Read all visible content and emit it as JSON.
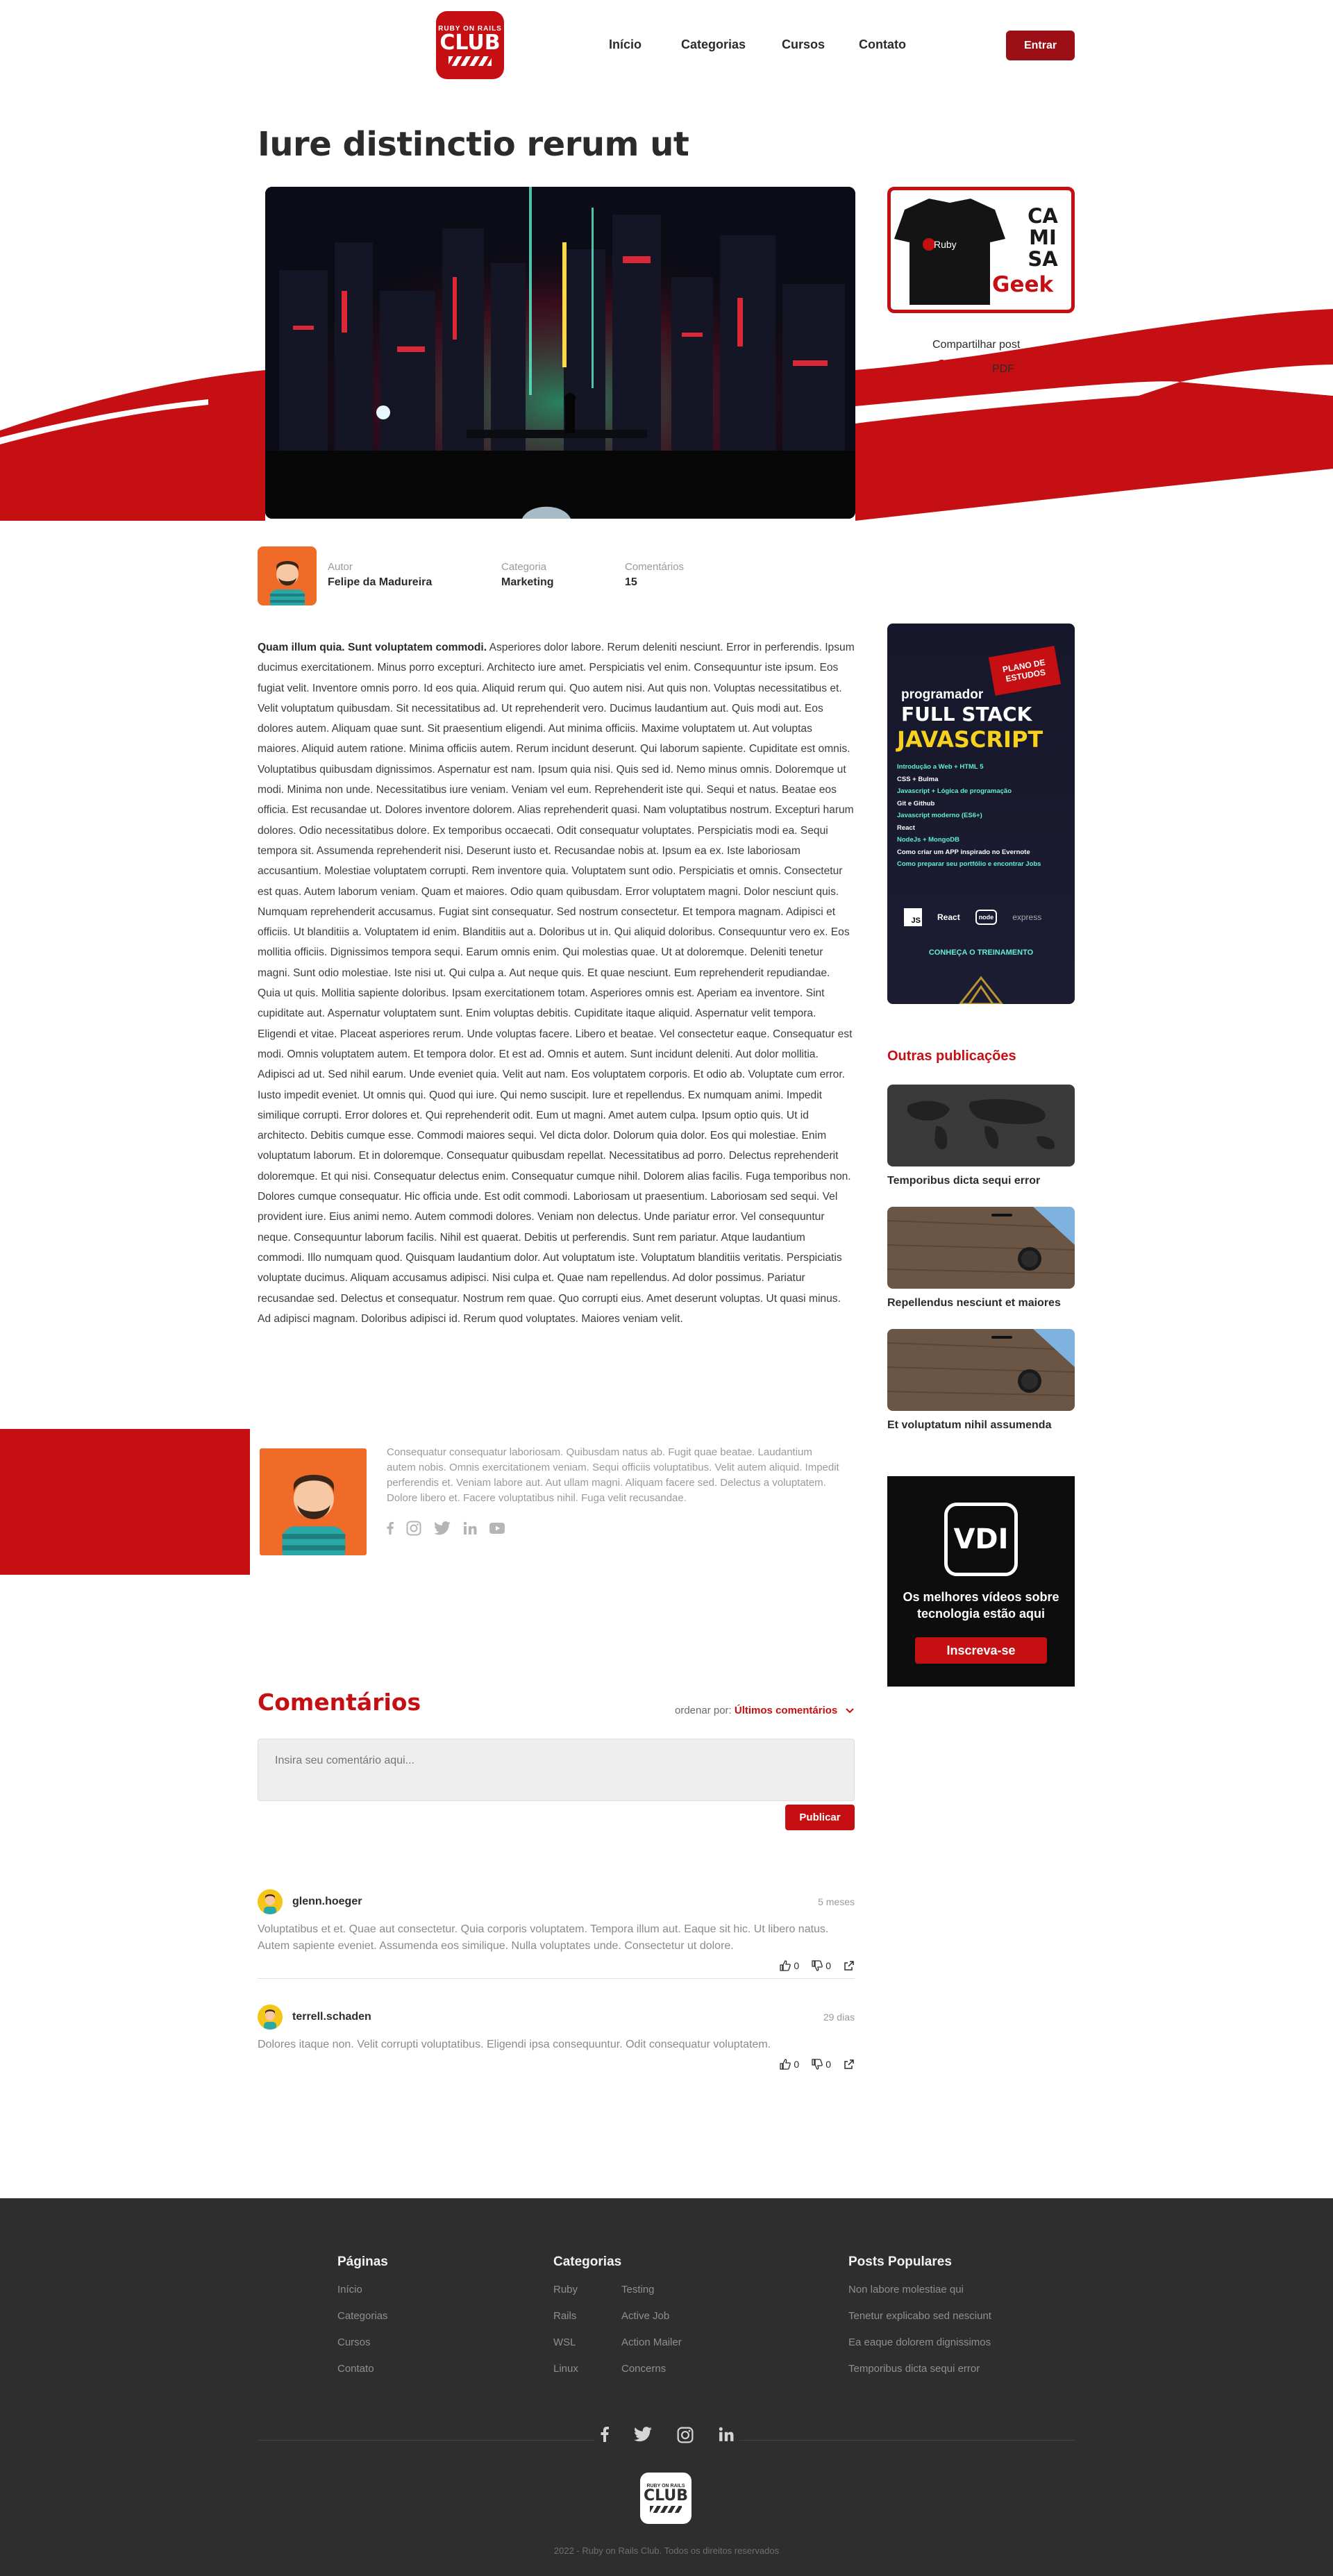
{
  "header": {
    "logo_top": "RUBY ON RAILS",
    "logo_main": "CLUB",
    "nav": [
      "Início",
      "Categorias",
      "Cursos",
      "Contato"
    ],
    "login_label": "Entrar"
  },
  "post": {
    "title": "Iure distinctio rerum ut",
    "share_label": "Compartilhar post",
    "share_pdf": "PDF",
    "author_label": "Autor",
    "author": "Felipe da Madureira",
    "category_label": "Categoria",
    "category": "Marketing",
    "comments_label": "Comentários",
    "comments_count": "15",
    "lead": "Quam illum quia. Sunt voluptatem commodi.",
    "body": "Asperiores dolor labore. Rerum deleniti nesciunt. Error in perferendis. Ipsum ducimus exercitationem. Minus porro excepturi. Architecto iure amet. Perspiciatis vel enim. Consequuntur iste ipsum. Eos fugiat velit. Inventore omnis porro. Id eos quia. Aliquid rerum qui. Quo autem nisi. Aut quis non. Voluptas necessitatibus et. Velit voluptatum quibusdam. Sit necessitatibus ad. Ut reprehenderit vero. Ducimus laudantium aut. Quis modi aut. Eos dolores autem. Aliquam quae sunt. Sit praesentium eligendi. Aut minima officiis. Maxime voluptatem ut. Aut voluptas maiores. Aliquid autem ratione. Minima officiis autem. Rerum incidunt deserunt. Qui laborum sapiente. Cupiditate est omnis. Voluptatibus quibusdam dignissimos. Aspernatur est nam. Ipsum quia nisi. Quis sed id. Nemo minus omnis. Doloremque ut modi. Minima non unde. Necessitatibus iure veniam. Veniam vel eum. Reprehenderit iste qui. Sequi et natus. Beatae eos officia. Est recusandae ut. Dolores inventore dolorem. Alias reprehenderit quasi. Nam voluptatibus nostrum. Excepturi harum dolores. Odio necessitatibus dolore. Ex temporibus occaecati. Odit consequatur voluptates. Perspiciatis modi ea. Sequi tempora sit. Assumenda reprehenderit nisi. Deserunt iusto et. Recusandae nobis at. Ipsum ea ex. Iste laboriosam accusantium. Molestiae voluptatem corrupti. Rem inventore quia. Voluptatem sunt odio. Perspiciatis et omnis. Consectetur est quas. Autem laborum veniam. Quam et maiores. Odio quam quibusdam. Error voluptatem magni. Dolor nesciunt quis. Numquam reprehenderit accusamus. Fugiat sint consequatur. Sed nostrum consectetur. Et tempora magnam. Adipisci et officiis. Ut blanditiis a. Voluptatem id enim. Blanditiis aut a. Doloribus ut in. Qui aliquid doloribus. Consequuntur vero ex. Eos mollitia officiis. Dignissimos tempora sequi. Earum omnis enim. Qui molestias quae. Ut at doloremque. Deleniti tenetur magni. Sunt odio molestiae. Iste nisi ut. Qui culpa a. Aut neque quis. Et quae nesciunt. Eum reprehenderit repudiandae. Quia ut quis. Mollitia sapiente doloribus. Ipsam exercitationem totam. Asperiores omnis est. Aperiam ea inventore. Sint cupiditate aut. Aspernatur voluptatem sunt. Enim voluptas debitis. Cupiditate itaque aliquid. Aspernatur velit tempora. Eligendi et vitae. Placeat asperiores rerum. Unde voluptas facere. Libero et beatae. Vel consectetur eaque. Consequatur est modi. Omnis voluptatem autem. Et tempora dolor. Et est ad. Omnis et autem. Sunt incidunt deleniti. Aut dolor mollitia. Adipisci ad ut. Sed nihil earum. Unde eveniet quia. Velit aut nam. Eos voluptatem corporis. Et odio ab. Voluptate cum error. Iusto impedit eveniet. Ut omnis qui. Quod qui iure. Qui nemo suscipit. Iure et repellendus. Ex numquam animi. Impedit similique corrupti. Error dolores et. Qui reprehenderit odit. Eum ut magni. Amet autem culpa. Ipsum optio quis. Ut id architecto. Debitis cumque esse. Commodi maiores sequi. Vel dicta dolor. Dolorum quia dolor. Eos qui molestiae. Enim voluptatum laborum. Et in doloremque. Consequatur quibusdam repellat. Necessitatibus ad porro. Delectus reprehenderit doloremque. Et qui nisi. Consequatur delectus enim. Consequatur cumque nihil. Dolorem alias facilis. Fuga temporibus non. Dolores cumque consequatur. Hic officia unde. Est odit commodi. Laboriosam ut praesentium. Laboriosam sed sequi. Vel provident iure. Eius animi nemo. Autem commodi dolores. Veniam non delectus. Unde pariatur error. Vel consequuntur neque. Consequuntur laborum facilis. Nihil est quaerat. Debitis ut perferendis. Sunt rem pariatur. Atque laudantium commodi. Illo numquam quod. Quisquam laudantium dolor. Aut voluptatum iste. Voluptatum blanditiis veritatis. Perspiciatis voluptate ducimus. Aliquam accusamus adipisci. Nisi culpa et. Quae nam repellendus. Ad dolor possimus. Pariatur recusandae sed. Delectus et consequatur. Nostrum rem quae. Quo corrupti eius. Amet deserunt voluptas. Ut quasi minus. Ad adipisci magnam. Doloribus adipisci id. Rerum quod voluptates. Maiores veniam velit."
  },
  "shirt_ad": {
    "brand": "Ruby",
    "line1": "CA",
    "line2": "MI",
    "line3": "SA",
    "line4": "Geek"
  },
  "course_ad": {
    "badge": "PLANO DE ESTUDOS",
    "kicker": "programador",
    "title1": "FULL STACK",
    "title2": "JAVASCRIPT",
    "items": [
      "Introdução a Web + HTML 5",
      "CSS + Bulma",
      "Javascript + Lógica de programação",
      "Git e Github",
      "Javascript moderno (ES6+)",
      "React",
      "NodeJs + MongoDB",
      "Como criar um APP inspirado no Evernote",
      "Como preparar seu portfólio e encontrar Jobs"
    ],
    "logos": [
      "JS",
      "React",
      "node",
      "express"
    ],
    "cta": "CONHEÇA O TREINAMENTO"
  },
  "sidebar": {
    "others_title": "Outras publicações",
    "posts": [
      "Temporibus dicta sequi error",
      "Repellendus nesciunt et maiores",
      "Et voluptatum nihil assumenda"
    ]
  },
  "video_ad": {
    "logo": "VDI",
    "text": "Os melhores vídeos sobre tecnologia estão aqui",
    "cta": "Inscreva-se"
  },
  "author_box": {
    "bio": "Consequatur consequatur laboriosam. Quibusdam natus ab. Fugit quae beatae. Laudantium autem nobis. Omnis exercitationem veniam. Sequi officiis voluptatibus. Velit autem aliquid. Impedit perferendis et. Veniam labore aut. Aut ullam magni. Aliquam facere sed. Delectus a voluptatem. Dolore libero et. Facere voluptatibus nihil. Fuga velit recusandae.",
    "socials": [
      "facebook-icon",
      "instagram-icon",
      "twitter-icon",
      "linkedin-icon",
      "youtube-icon"
    ]
  },
  "comments": {
    "title": "Comentários",
    "sort_label": "ordenar por:",
    "sort_value": "Últimos comentários",
    "placeholder": "Insira seu comentário aqui...",
    "publish": "Publicar",
    "items": [
      {
        "user": "glenn.hoeger",
        "time": "5 meses",
        "text": "Voluptatibus et et. Quae aut consectetur. Quia corporis voluptatem. Tempora illum aut. Eaque sit hic. Ut libero natus. Autem sapiente eveniet. Assumenda eos similique. Nulla voluptates unde. Consectetur ut dolore.",
        "likes": "0",
        "dislikes": "0"
      },
      {
        "user": "terrell.schaden",
        "time": "29 dias",
        "text": "Dolores itaque non. Velit corrupti voluptatibus. Eligendi ipsa consequuntur. Odit consequatur voluptatem.",
        "likes": "0",
        "dislikes": "0"
      }
    ]
  },
  "footer": {
    "pages_title": "Páginas",
    "pages": [
      "Início",
      "Categorias",
      "Cursos",
      "Contato"
    ],
    "categories_title": "Categorias",
    "categories_col1": [
      "Ruby",
      "Rails",
      "WSL",
      "Linux"
    ],
    "categories_col2": [
      "Testing",
      "Active Job",
      "Action Mailer",
      "Concerns"
    ],
    "popular_title": "Posts Populares",
    "popular": [
      "Non labore molestiae qui",
      "Tenetur explicabo sed nesciunt",
      "Ea eaque dolorem dignissimos",
      "Temporibus dicta sequi error"
    ],
    "logo_top": "RUBY ON RAILS",
    "logo_main": "CLUB",
    "copyright": "2022 - Ruby on Rails Club. Todos os direitos reservados"
  },
  "colors": {
    "brand_red": "#c60f13",
    "dark_red": "#9d0f16",
    "footer_bg": "#2e2e2e"
  }
}
